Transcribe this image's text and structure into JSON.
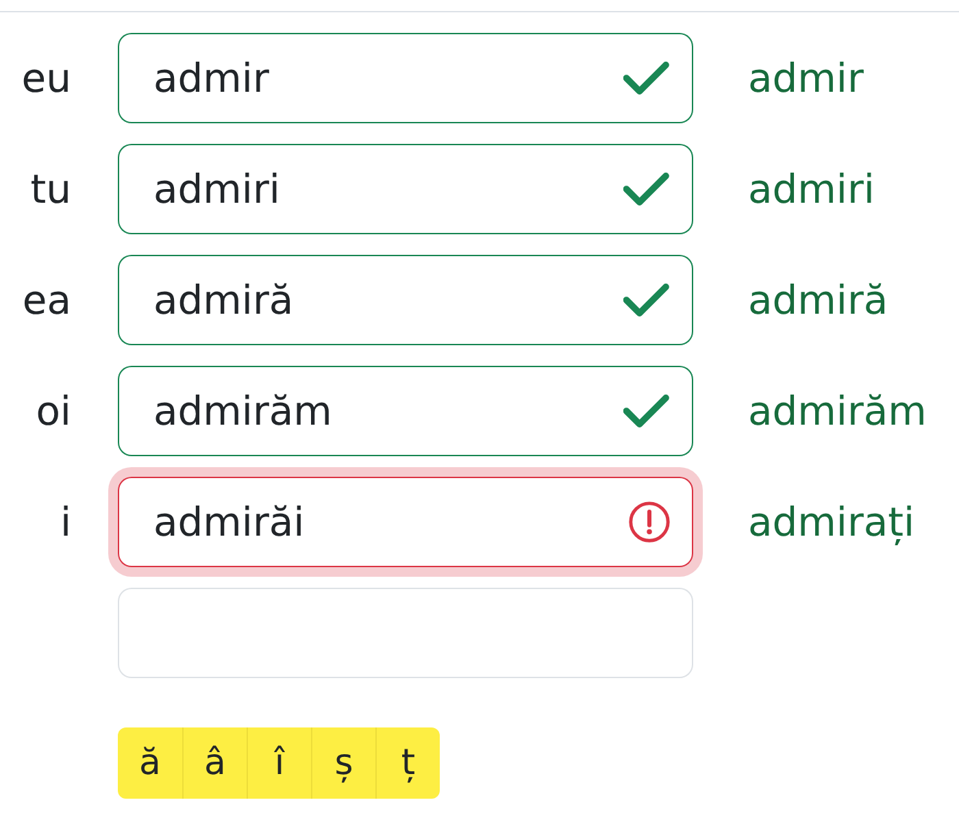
{
  "rows": [
    {
      "pronoun": "eu",
      "value": "admir",
      "kind": "correct",
      "focused": false,
      "answer": "admir"
    },
    {
      "pronoun": "tu",
      "value": "admiri",
      "kind": "correct",
      "focused": false,
      "answer": "admiri"
    },
    {
      "pronoun": "ea",
      "value": "admiră",
      "kind": "correct",
      "focused": false,
      "answer": "admiră"
    },
    {
      "pronoun": "oi",
      "value": "admirăm",
      "kind": "correct",
      "focused": false,
      "answer": "admirăm"
    },
    {
      "pronoun": "i",
      "value": "admirăi",
      "kind": "incorrect",
      "focused": true,
      "answer": "admirați"
    },
    {
      "kind": "empty",
      "focused": false
    }
  ],
  "special_characters": [
    "ă",
    "â",
    "î",
    "ș",
    "ț"
  ]
}
